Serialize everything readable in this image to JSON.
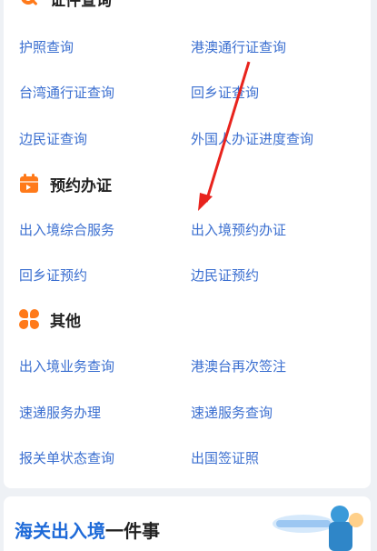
{
  "sections": {
    "query": {
      "title": "证件查询",
      "items": [
        "护照查询",
        "港澳通行证查询",
        "台湾通行证查询",
        "回乡证查询",
        "边民证查询",
        "外国人办证进度查询"
      ]
    },
    "appointment": {
      "title": "预约办证",
      "items": [
        "出入境综合服务",
        "出入境预约办证",
        "回乡证预约",
        "边民证预约"
      ]
    },
    "other": {
      "title": "其他",
      "items": [
        "出入境业务查询",
        "港澳台再次签注",
        "速递服务办理",
        "速递服务查询",
        "报关单状态查询",
        "出国签证照"
      ]
    }
  },
  "bottom_banner": {
    "title_highlight": "海关出入境",
    "title_rest": "一件事"
  },
  "colors": {
    "accent_orange": "#ff7a1a",
    "link_blue": "#3b6fd0",
    "annotation_red": "#e8231d"
  }
}
